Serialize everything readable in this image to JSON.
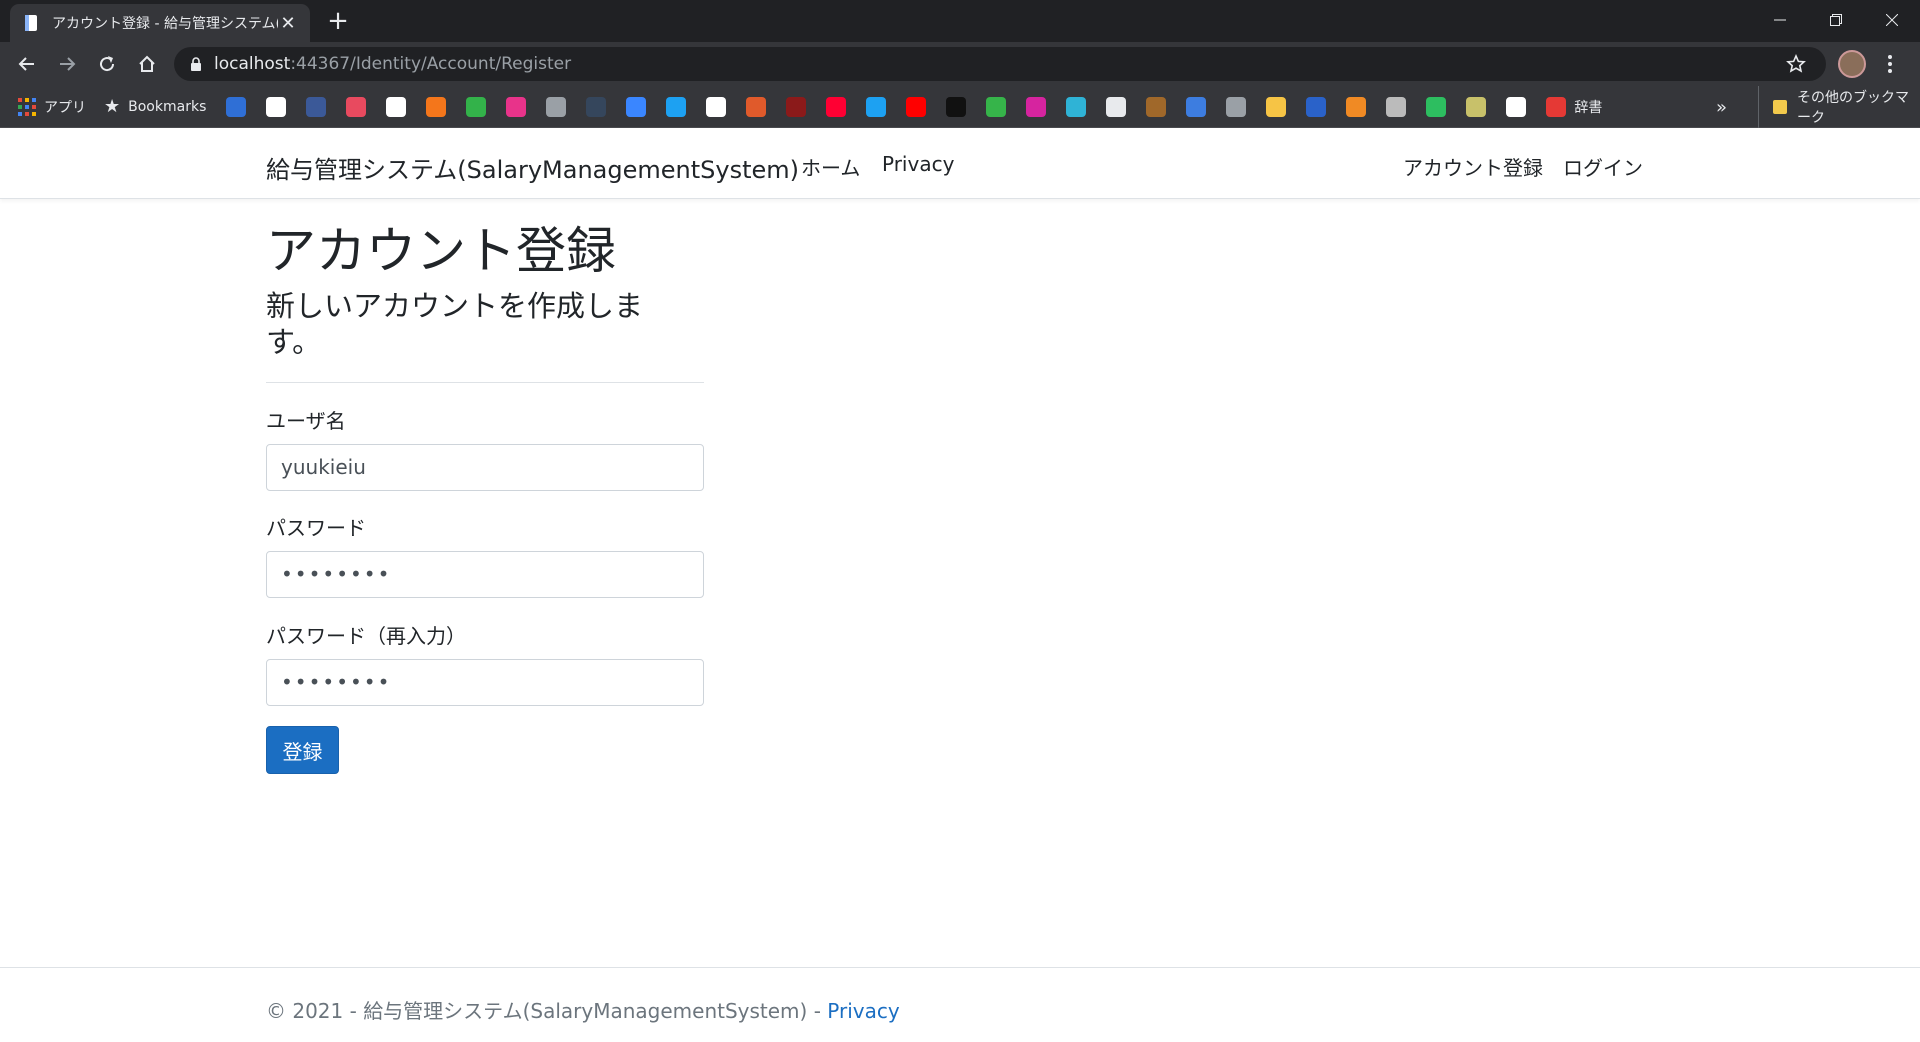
{
  "browser": {
    "tab_title": "アカウント登録 - 給与管理システム(S",
    "url_host": "localhost",
    "url_path": ":44367/Identity/Account/Register",
    "bookmarks": [
      {
        "label": "アプリ",
        "icon": "apps-grid-icon",
        "color": "#e8eaed"
      },
      {
        "label": "Bookmarks",
        "icon": "star-icon",
        "color": "#e8eaed"
      }
    ],
    "bookmark_icons": [
      {
        "icon": "a-icon",
        "color": "#2f6fd6"
      },
      {
        "icon": "amazon-icon",
        "color": "#ffffff"
      },
      {
        "icon": "facebook-icon",
        "color": "#3b5998"
      },
      {
        "icon": "f-red-icon",
        "color": "#e84a5f"
      },
      {
        "icon": "google-icon",
        "color": "#ffffff"
      },
      {
        "icon": "g-orange-icon",
        "color": "#f4761b"
      },
      {
        "icon": "green-circle-icon",
        "color": "#33b24a"
      },
      {
        "icon": "p-pink-icon",
        "color": "#e8338a"
      },
      {
        "icon": "doc-icon",
        "color": "#9aa0a6"
      },
      {
        "icon": "tumblr-icon",
        "color": "#35465c"
      },
      {
        "icon": "blue-chat-icon",
        "color": "#3a86ff"
      },
      {
        "icon": "twitter-square-icon",
        "color": "#1da1f2"
      },
      {
        "icon": "wikipedia-icon",
        "color": "#ffffff"
      },
      {
        "icon": "w-red-icon",
        "color": "#e05a2b"
      },
      {
        "icon": "creature-icon",
        "color": "#8b1a1a"
      },
      {
        "icon": "yahoo-icon",
        "color": "#ff0033"
      },
      {
        "icon": "twitter-icon",
        "color": "#1da1f2"
      },
      {
        "icon": "youtube-icon",
        "color": "#ff0000"
      },
      {
        "icon": "apple-icon",
        "color": "#111111"
      },
      {
        "icon": "clover-icon",
        "color": "#36b44a"
      },
      {
        "icon": "instagram-icon",
        "color": "#d6249f"
      },
      {
        "icon": "pulse-icon",
        "color": "#2fb3d6"
      },
      {
        "icon": "mq-icon",
        "color": "#e8eaed"
      },
      {
        "icon": "badge-icon",
        "color": "#a0682a"
      },
      {
        "icon": "com-icon",
        "color": "#3d7de0"
      },
      {
        "icon": "phone-icon",
        "color": "#9aa0a6"
      },
      {
        "icon": "music-icon",
        "color": "#f6c445"
      },
      {
        "icon": "dictionary-icon",
        "color": "#2a62c9"
      },
      {
        "icon": "mascot-icon",
        "color": "#f08a24"
      },
      {
        "icon": "search-leaf-icon",
        "color": "#bbbbbb"
      },
      {
        "icon": "evernote-icon",
        "color": "#2dbe60"
      },
      {
        "icon": "barcode-icon",
        "color": "#c8c16a"
      },
      {
        "icon": "github-icon",
        "color": "#ffffff"
      }
    ],
    "dict_label": "辞書",
    "other_bookmarks": "その他のブックマーク",
    "more": "»"
  },
  "navbar": {
    "brand": "給与管理システム(SalaryManagementSystem)",
    "home": "ホーム",
    "privacy": "Privacy",
    "register": "アカウント登録",
    "login": "ログイン"
  },
  "page": {
    "title": "アカウント登録",
    "subtitle": "新しいアカウントを作成します。"
  },
  "form": {
    "username_label": "ユーザ名",
    "username_value": "yuukieiu",
    "password_label": "パスワード",
    "password_value": "••••••••",
    "confirm_label": "パスワード（再入力）",
    "confirm_value": "••••••••",
    "submit_label": "登録"
  },
  "footer": {
    "text": "© 2021 - 給与管理システム(SalaryManagementSystem) - ",
    "link": "Privacy"
  },
  "colors": {
    "primary": "#1b6ec2",
    "chrome_dark": "#202124",
    "chrome_toolbar": "#35363a"
  }
}
